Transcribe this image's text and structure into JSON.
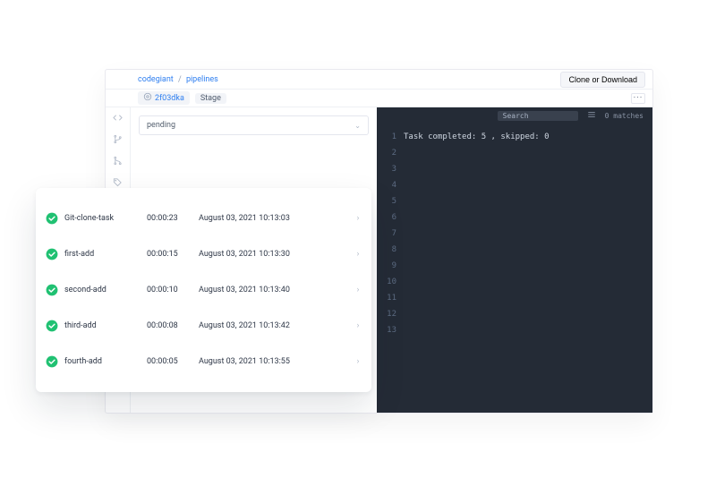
{
  "breadcrumb": {
    "root": "codegiant",
    "sep": "/",
    "leaf": "pipelines"
  },
  "header": {
    "download": "Clone or Download"
  },
  "commit": {
    "hash": "2f03dka",
    "stage_label": "Stage"
  },
  "status_select": {
    "value": "pending"
  },
  "console": {
    "search_placeholder": "Search",
    "matches": "0 matches",
    "line_count": 13,
    "lines": [
      "Task completed: 5 , skipped: 0",
      "",
      "",
      "",
      "",
      "",
      "",
      "",
      "",
      "",
      "",
      "",
      ""
    ]
  },
  "tasks": [
    {
      "name": "Git-clone-task",
      "duration": "00:00:23",
      "timestamp": "August 03, 2021  10:13:03"
    },
    {
      "name": "first-add",
      "duration": "00:00:15",
      "timestamp": "August 03, 2021  10:13:30"
    },
    {
      "name": "second-add",
      "duration": "00:00:10",
      "timestamp": "August 03, 2021  10:13:40"
    },
    {
      "name": "third-add",
      "duration": "00:00:08",
      "timestamp": "August 03, 2021  10:13:42"
    },
    {
      "name": "fourth-add",
      "duration": "00:00:05",
      "timestamp": "August 03, 2021  10:13:55"
    }
  ]
}
